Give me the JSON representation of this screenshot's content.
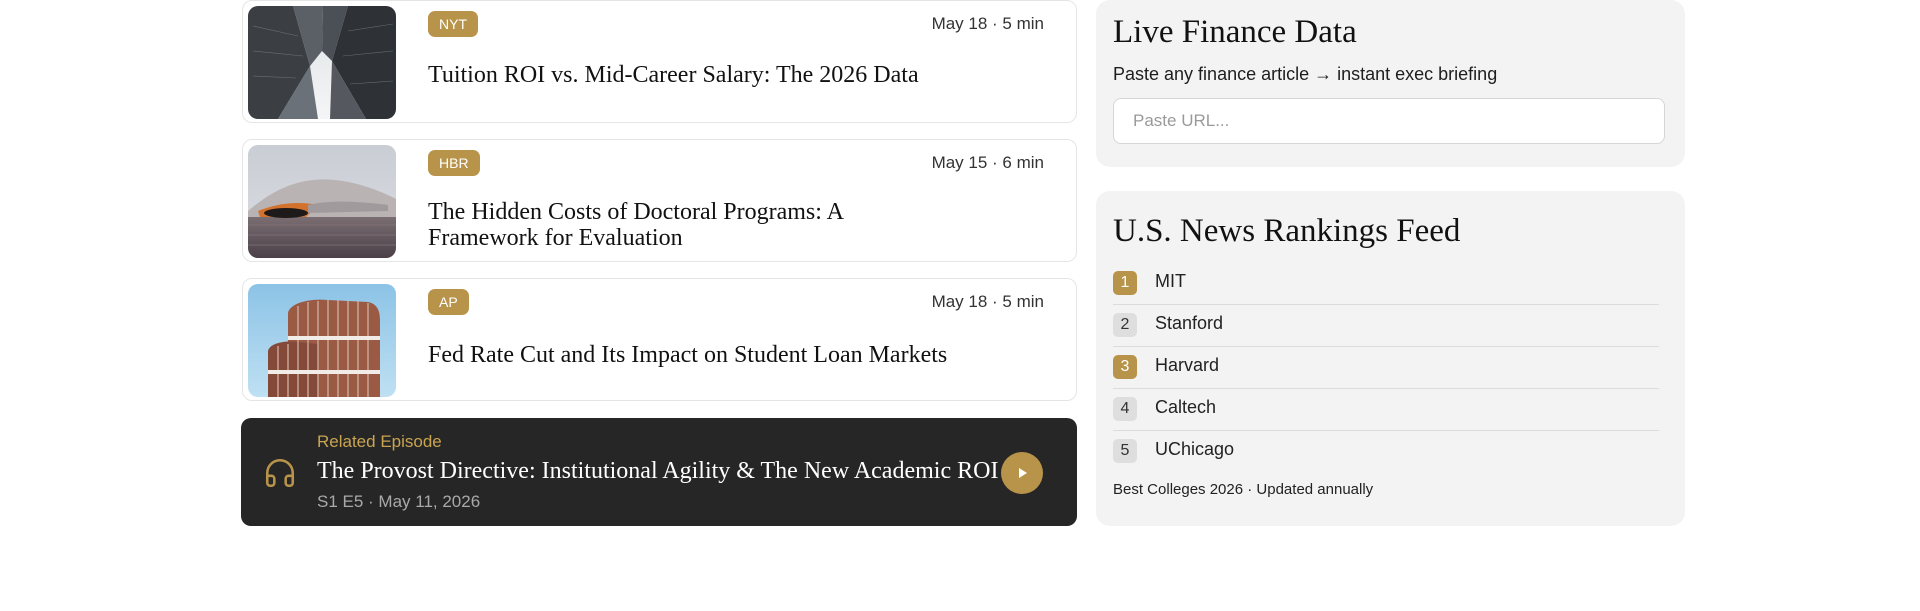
{
  "articles": [
    {
      "source": "NYT",
      "meta": "May 18 · 5 min",
      "title": "Tuition ROI vs. Mid-Career Salary: The 2026 Data"
    },
    {
      "source": "HBR",
      "meta": "May 15 · 6 min",
      "title": "The Hidden Costs of Doctoral Programs: A Framework for Evaluation"
    },
    {
      "source": "AP",
      "meta": "May 18 · 5 min",
      "title": "Fed Rate Cut and Its Impact on Student Loan Markets"
    }
  ],
  "episode": {
    "label": "Related Episode",
    "title": "The Provost Directive: Institutional Agility & The New Academic ROI",
    "meta": "S1 E5 · May 11, 2026",
    "icon": "headphones-icon",
    "play_icon": "play-icon"
  },
  "finance": {
    "title": "Live Finance Data",
    "subtitle": "Paste any finance article → instant exec briefing",
    "placeholder": "Paste URL..."
  },
  "rankings": {
    "title": "U.S. News Rankings Feed",
    "items": [
      {
        "rank": "1",
        "name": "MIT"
      },
      {
        "rank": "2",
        "name": "Stanford"
      },
      {
        "rank": "3",
        "name": "Harvard"
      },
      {
        "rank": "4",
        "name": "Caltech"
      },
      {
        "rank": "5",
        "name": "UChicago"
      }
    ],
    "footer": "Best Colleges 2026 · Updated annually"
  },
  "colors": {
    "accent": "#b8944a",
    "dark_card": "#262626",
    "panel_bg": "#f3f3f3"
  }
}
